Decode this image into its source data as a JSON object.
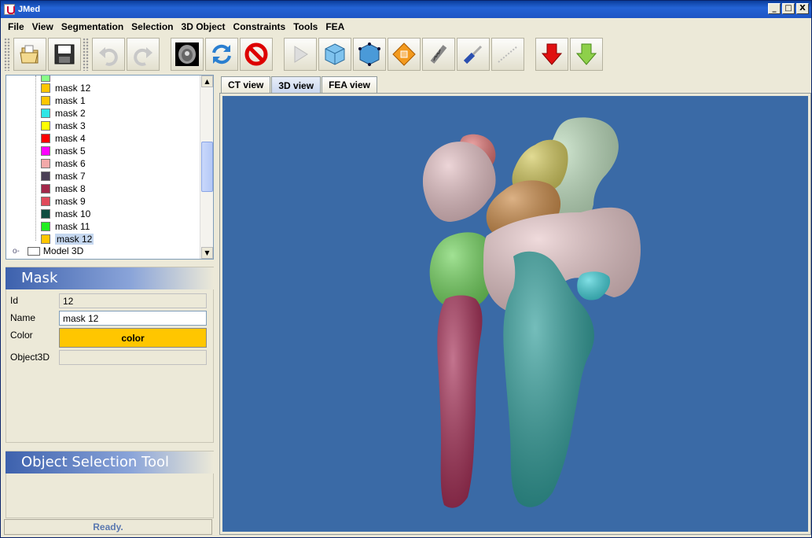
{
  "window": {
    "title": "JMed",
    "controls": {
      "minimize": "_",
      "maximize": "□",
      "close": "X"
    }
  },
  "menu": [
    "File",
    "View",
    "Segmentation",
    "Selection",
    "3D Object",
    "Constraints",
    "Tools",
    "FEA"
  ],
  "toolbar": {
    "buttons": [
      {
        "icon": "open-folder-icon"
      },
      {
        "icon": "save-disk-icon"
      },
      {
        "icon": "undo-icon"
      },
      {
        "icon": "redo-icon"
      },
      {
        "icon": "ct-scan-icon"
      },
      {
        "icon": "refresh-icon"
      },
      {
        "icon": "stop-icon"
      },
      {
        "icon": "play-icon"
      },
      {
        "icon": "cube-icon"
      },
      {
        "icon": "cube-points-icon"
      },
      {
        "icon": "mesh-diamond-icon"
      },
      {
        "icon": "screw-icon"
      },
      {
        "icon": "screwdriver-icon"
      },
      {
        "icon": "measure-line-icon"
      },
      {
        "icon": "import-down-arrow-red-icon"
      },
      {
        "icon": "export-down-arrow-green-icon"
      }
    ]
  },
  "tree": {
    "items": [
      {
        "label": "mask 12",
        "color": "#ffc600"
      },
      {
        "label": "mask 1",
        "color": "#ffc600"
      },
      {
        "label": "mask 2",
        "color": "#2fe6e6"
      },
      {
        "label": "mask 3",
        "color": "#ffff00"
      },
      {
        "label": "mask 4",
        "color": "#ff0000"
      },
      {
        "label": "mask 5",
        "color": "#ff00ff"
      },
      {
        "label": "mask 6",
        "color": "#f2a9a9"
      },
      {
        "label": "mask 7",
        "color": "#4a3f55"
      },
      {
        "label": "mask 8",
        "color": "#a3284a"
      },
      {
        "label": "mask 9",
        "color": "#e04a5a"
      },
      {
        "label": "mask 10",
        "color": "#0f4d40"
      },
      {
        "label": "mask 11",
        "color": "#22ee22"
      },
      {
        "label": "mask 12",
        "color": "#ffc600",
        "selected": true
      }
    ],
    "root_node": "Model 3D"
  },
  "mask_panel": {
    "title": "Mask",
    "id_label": "Id",
    "id_value": "12",
    "name_label": "Name",
    "name_value": "mask 12",
    "color_label": "Color",
    "color_button": "color",
    "object3d_label": "Object3D",
    "object3d_value": ""
  },
  "selection_panel": {
    "title": "Object Selection Tool"
  },
  "status": "Ready.",
  "tabs": [
    {
      "label": "CT view",
      "active": false
    },
    {
      "label": "3D view",
      "active": true
    },
    {
      "label": "FEA view",
      "active": false
    }
  ],
  "scene": {
    "background": "#3a6aa6",
    "objects": [
      {
        "name": "radius-bone",
        "color": "#2a9a96"
      },
      {
        "name": "ulna-bone",
        "color": "#a32a52"
      },
      {
        "name": "lunate-bone",
        "color": "#6fd25a"
      },
      {
        "name": "scaphoid-bone",
        "color": "#e3bfc3"
      },
      {
        "name": "capitate-bone",
        "color": "#c98844"
      },
      {
        "name": "trapezoid-bone",
        "color": "#d2c85a"
      },
      {
        "name": "trapezium-bone",
        "color": "#b9dab9"
      },
      {
        "name": "hamate-bone",
        "color": "#e7c7c9"
      },
      {
        "name": "pisiform-bone",
        "color": "#e07373"
      },
      {
        "name": "triquetrum-bone",
        "color": "#3ed0d8"
      }
    ]
  }
}
